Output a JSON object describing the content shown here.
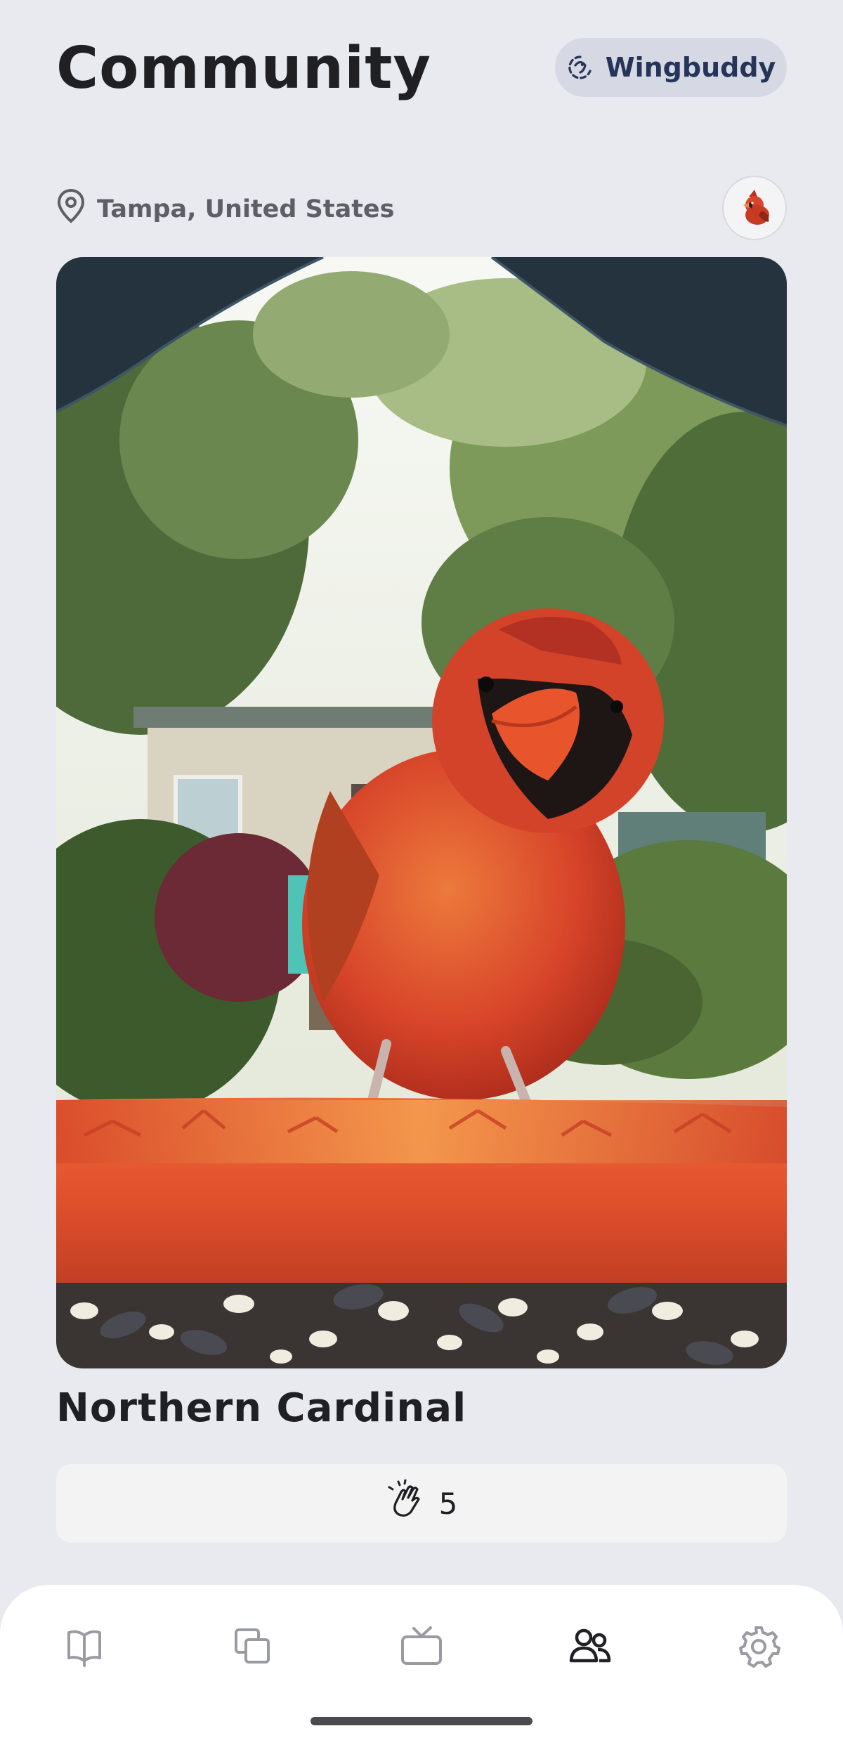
{
  "header": {
    "title": "Community",
    "wingbuddy_label": "Wingbuddy"
  },
  "post": {
    "location": "Tampa, United States",
    "avatar_icon": "cardinal-avatar-icon",
    "species": "Northern Cardinal",
    "claps": "5"
  },
  "tabbar": {
    "items": [
      {
        "icon": "book-icon",
        "active": false
      },
      {
        "icon": "gallery-icon",
        "active": false
      },
      {
        "icon": "tv-icon",
        "active": false
      },
      {
        "icon": "community-icon",
        "active": true
      },
      {
        "icon": "settings-icon",
        "active": false
      }
    ]
  },
  "colors": {
    "background": "#e9eaf0",
    "accent_button": "#d6d9e4",
    "accent_text": "#27345a",
    "inactive_icon": "#9a9ba2",
    "active_icon": "#1f1f24",
    "cardinal_red": "#d9452b"
  }
}
